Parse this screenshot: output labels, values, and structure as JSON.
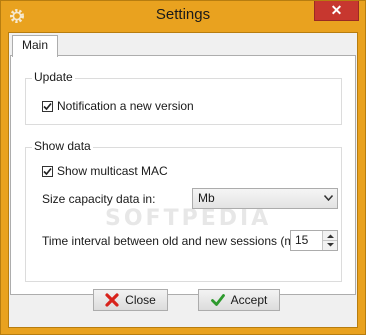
{
  "window": {
    "title": "Settings",
    "close_glyph": "✕",
    "icon": "gear-icon",
    "accent_color": "#e9a21f"
  },
  "tabs": [
    {
      "label": "Main",
      "selected": true
    }
  ],
  "update_group": {
    "title": "Update",
    "notification_label": "Notification a new version",
    "notification_checked": true
  },
  "show_data_group": {
    "title": "Show data",
    "multicast_label": "Show multicast MAC",
    "multicast_checked": true,
    "size_capacity_label": "Size capacity data in:",
    "size_capacity_value": "Mb",
    "interval_label": "Time interval between old and new sessions (min):",
    "interval_value": "15"
  },
  "buttons": {
    "close_label": "Close",
    "close_icon": "red-x-icon",
    "accept_label": "Accept",
    "accept_icon": "green-check-icon"
  },
  "watermark": "SOFTPEDIA"
}
